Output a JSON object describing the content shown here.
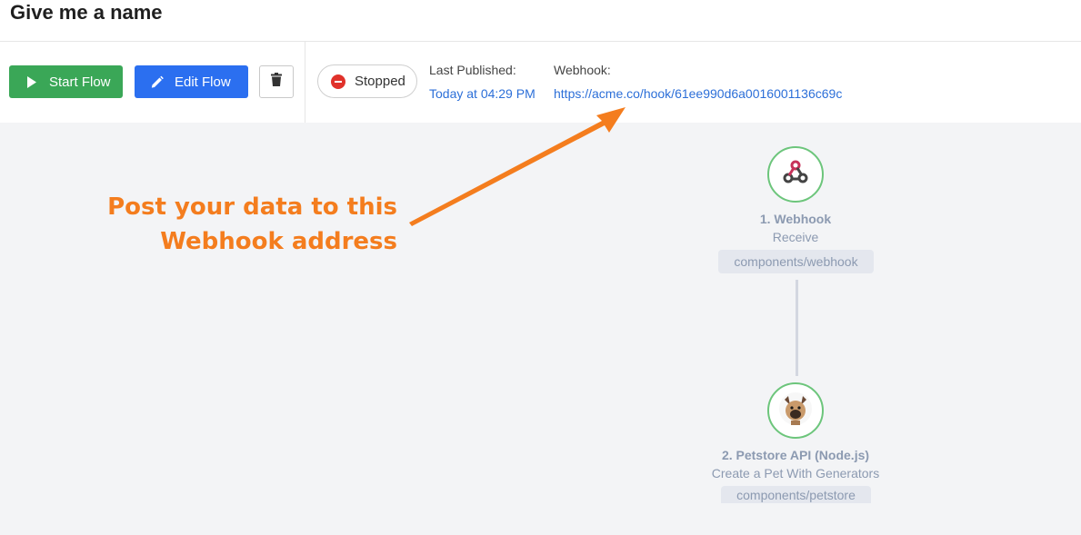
{
  "page": {
    "title": "Give me a name"
  },
  "toolbar": {
    "start_label": "Start Flow",
    "edit_label": "Edit Flow",
    "status": "Stopped",
    "last_published_label": "Last Published:",
    "last_published_value": "Today at 04:29 PM",
    "webhook_label": "Webhook:",
    "webhook_url": "https://acme.co/hook/61ee990d6a0016001136c69c"
  },
  "annotation": {
    "line1": "Post your data to this",
    "line2": "Webhook address"
  },
  "nodes": [
    {
      "title": "1. Webhook",
      "subtitle": "Receive",
      "tag": "components/webhook",
      "icon": "webhook-icon"
    },
    {
      "title": "2. Petstore API (Node.js)",
      "subtitle": "Create a Pet With Generators",
      "tag": "components/petstore",
      "icon": "dog-icon"
    }
  ],
  "colors": {
    "start_button": "#3aa757",
    "edit_button": "#2b6ff0",
    "status_stopped": "#e0322b",
    "link": "#2c6fd8",
    "annotation": "#f47d1e",
    "node_border": "#6cc57b"
  }
}
